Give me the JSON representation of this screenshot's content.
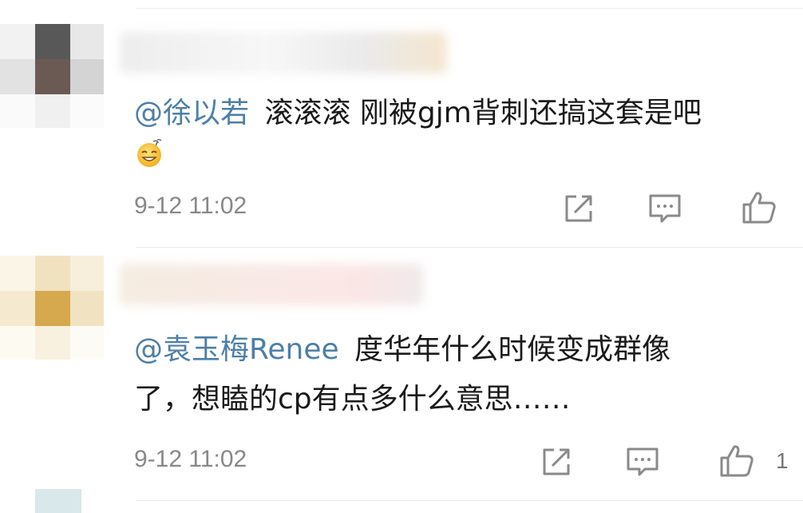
{
  "comments": [
    {
      "mention": "@徐以若",
      "line1": "滚滚滚 刚被gjm背刺还搞这套是吧",
      "line2": "",
      "emoji": "grin-sweat-emoji",
      "timestamp": "9-12 11:02",
      "like_count": ""
    },
    {
      "mention": "@袁玉梅Renee",
      "line1": "度华年什么时候变成群像",
      "line2": "了，想瞌的cp有点多什么意思……",
      "emoji": "",
      "timestamp": "9-12 11:02",
      "like_count": "1"
    }
  ],
  "icons": {
    "share": "share-icon",
    "comment": "comment-icon",
    "like": "thumbs-up-icon"
  },
  "colors": {
    "mention": "#4d7fa8",
    "text": "#1a1a1a",
    "meta": "#888888",
    "icon": "#8a8a8a"
  }
}
